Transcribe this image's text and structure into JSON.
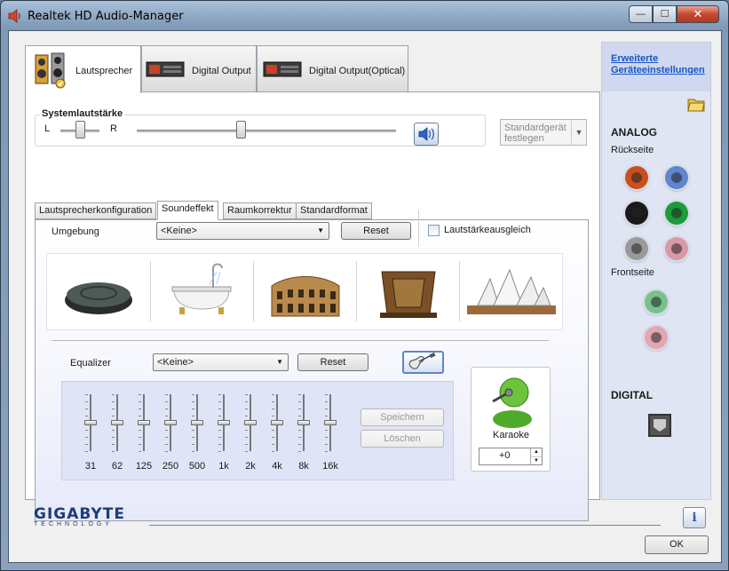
{
  "window": {
    "title": "Realtek HD Audio-Manager",
    "controls": {
      "minimize": "—",
      "maximize": "☐",
      "close": "✕"
    }
  },
  "device_tabs": [
    {
      "label": "Lautsprecher",
      "icon": "speakers-icon",
      "active": true
    },
    {
      "label": "Digital Output",
      "icon": "digital-output-device-icon",
      "active": false
    },
    {
      "label": "Digital Output(Optical)",
      "icon": "optical-output-device-icon",
      "active": false
    }
  ],
  "system_volume": {
    "label": "Systemlautstärke",
    "balance_left": "L",
    "balance_right": "R",
    "balance_level": 0.5,
    "volume_level": 0.4,
    "mute_icon": "speaker-volume-icon"
  },
  "default_device": {
    "label": "Standardgerät festlegen",
    "enabled": false
  },
  "sub_tabs": [
    {
      "label": "Lautsprecherkonfiguration",
      "active": false
    },
    {
      "label": "Soundeffekt",
      "active": true
    },
    {
      "label": "Raumkorrektur",
      "active": false
    },
    {
      "label": "Standardformat",
      "active": false
    }
  ],
  "environment": {
    "label": "Umgebung",
    "selected": "<Keine>",
    "reset_label": "Reset",
    "loudness_label": "Lautstärkeausgleich",
    "loudness_checked": false,
    "presets": [
      "stone-disc-icon",
      "bathtub-icon",
      "colosseum-icon",
      "wooden-room-icon",
      "opera-house-icon"
    ]
  },
  "equalizer": {
    "label": "Equalizer",
    "selected": "<Keine>",
    "reset_label": "Reset",
    "guitar_icon": "guitar-icon",
    "bands": [
      {
        "freq": "31",
        "level": 0.5
      },
      {
        "freq": "62",
        "level": 0.5
      },
      {
        "freq": "125",
        "level": 0.5
      },
      {
        "freq": "250",
        "level": 0.5
      },
      {
        "freq": "500",
        "level": 0.5
      },
      {
        "freq": "1k",
        "level": 0.5
      },
      {
        "freq": "2k",
        "level": 0.5
      },
      {
        "freq": "4k",
        "level": 0.5
      },
      {
        "freq": "8k",
        "level": 0.5
      },
      {
        "freq": "16k",
        "level": 0.5
      }
    ],
    "save_label": "Speichern",
    "delete_label": "Löschen"
  },
  "karaoke": {
    "label": "Karaoke",
    "value": "+0",
    "icon": "karaoke-singer-icon"
  },
  "side_panel": {
    "advanced_link": "Erweiterte Geräteeinstellungen",
    "folder_icon": "folder-icon",
    "analog_title": "ANALOG",
    "rear_label": "Rückseite",
    "front_label": "Frontseite",
    "digital_title": "DIGITAL",
    "rear_jacks": [
      "#c8501e",
      "#5f86cf",
      "#1a1a1a",
      "#1e9a3a",
      "#9a9a9a",
      "#d79aa6"
    ],
    "front_jacks": [
      "#77c28c",
      "#e3a7b2"
    ],
    "digital_icon": "spdif-port-icon"
  },
  "footer": {
    "brand": "GIGABYTE",
    "brand_sub": "TECHNOLOGY",
    "info_label": "i",
    "ok_label": "OK"
  }
}
